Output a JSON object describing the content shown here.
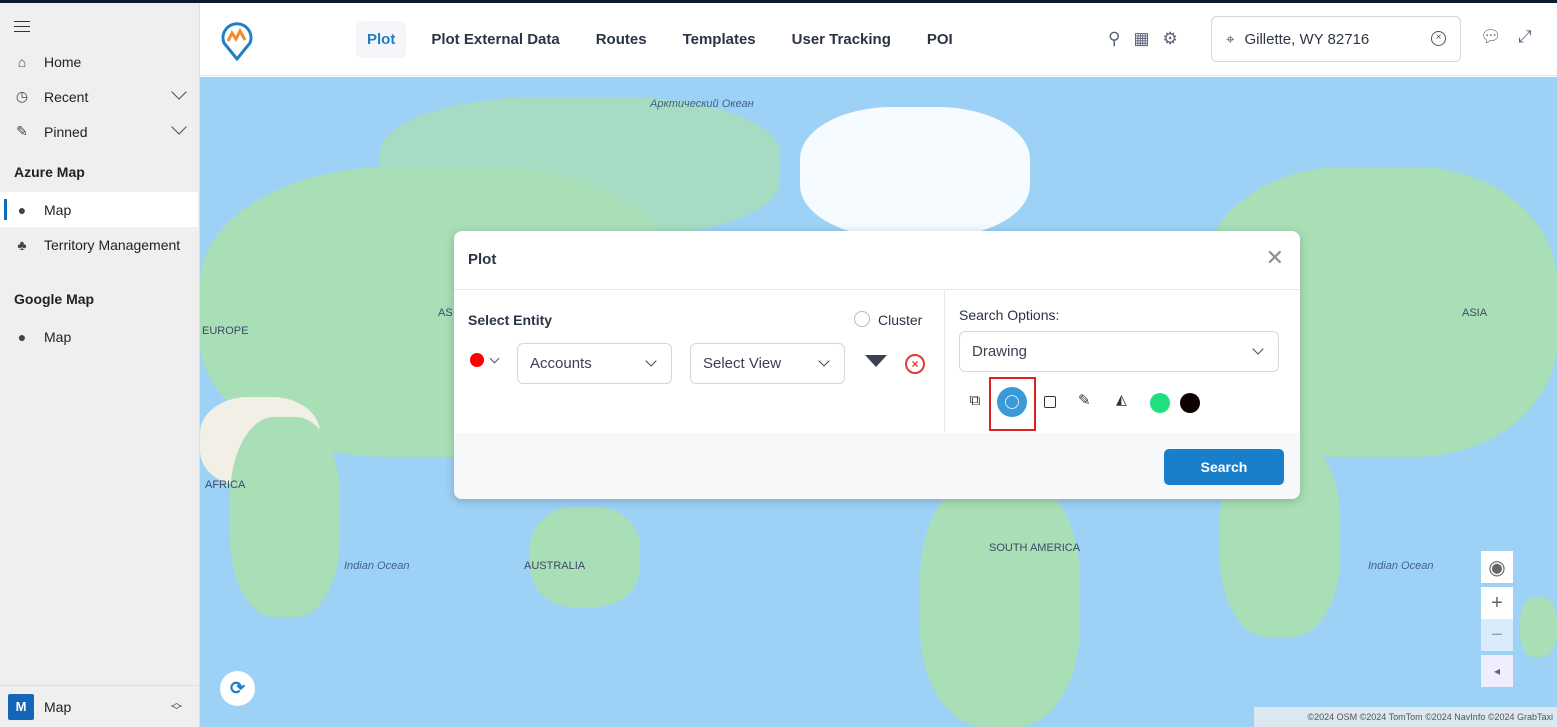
{
  "sidebar": {
    "items": [
      {
        "label": "Home",
        "icon": "home-icon"
      },
      {
        "label": "Recent",
        "icon": "clock-icon"
      },
      {
        "label": "Pinned",
        "icon": "pin-icon"
      }
    ],
    "sections": [
      {
        "title": "Azure Map",
        "items": [
          {
            "label": "Map",
            "icon": "map-marker-icon",
            "active": true
          },
          {
            "label": "Territory Management",
            "icon": "territory-icon"
          }
        ]
      },
      {
        "title": "Google Map",
        "items": [
          {
            "label": "Map",
            "icon": "map-marker-icon"
          }
        ]
      }
    ],
    "area": {
      "badge": "M",
      "label": "Map"
    }
  },
  "header": {
    "tabs": [
      "Plot",
      "Plot External Data",
      "Routes",
      "Templates",
      "User Tracking",
      "POI"
    ],
    "active_tab": "Plot",
    "location": "Gillette, WY 82716"
  },
  "map": {
    "labels": {
      "arctic": "Арктический Океан",
      "europe": "EUROPE",
      "asia_partial": "AS",
      "africa": "AFRICA",
      "indian_ocean_left": "Indian Ocean",
      "australia": "AUSTRALIA",
      "south_america": "SOUTH AMERICA",
      "indian_ocean_right": "Indian Ocean",
      "asia": "ASIA"
    },
    "attribution": "©2024 OSM ©2024 TomTom ©2024 NavInfo ©2024 GrabTaxi"
  },
  "plot_modal": {
    "title": "Plot",
    "select_entity_label": "Select Entity",
    "cluster_label": "Cluster",
    "entity_value": "Accounts",
    "view_placeholder": "Select View",
    "search_options_label": "Search Options:",
    "search_option_value": "Drawing",
    "colors": {
      "green": "#1fe07f",
      "black": "#0d0000",
      "marker": "#ff0000",
      "selected_tool": "#3a9ad9"
    },
    "selected_tool": "circle",
    "search_button": "Search"
  }
}
